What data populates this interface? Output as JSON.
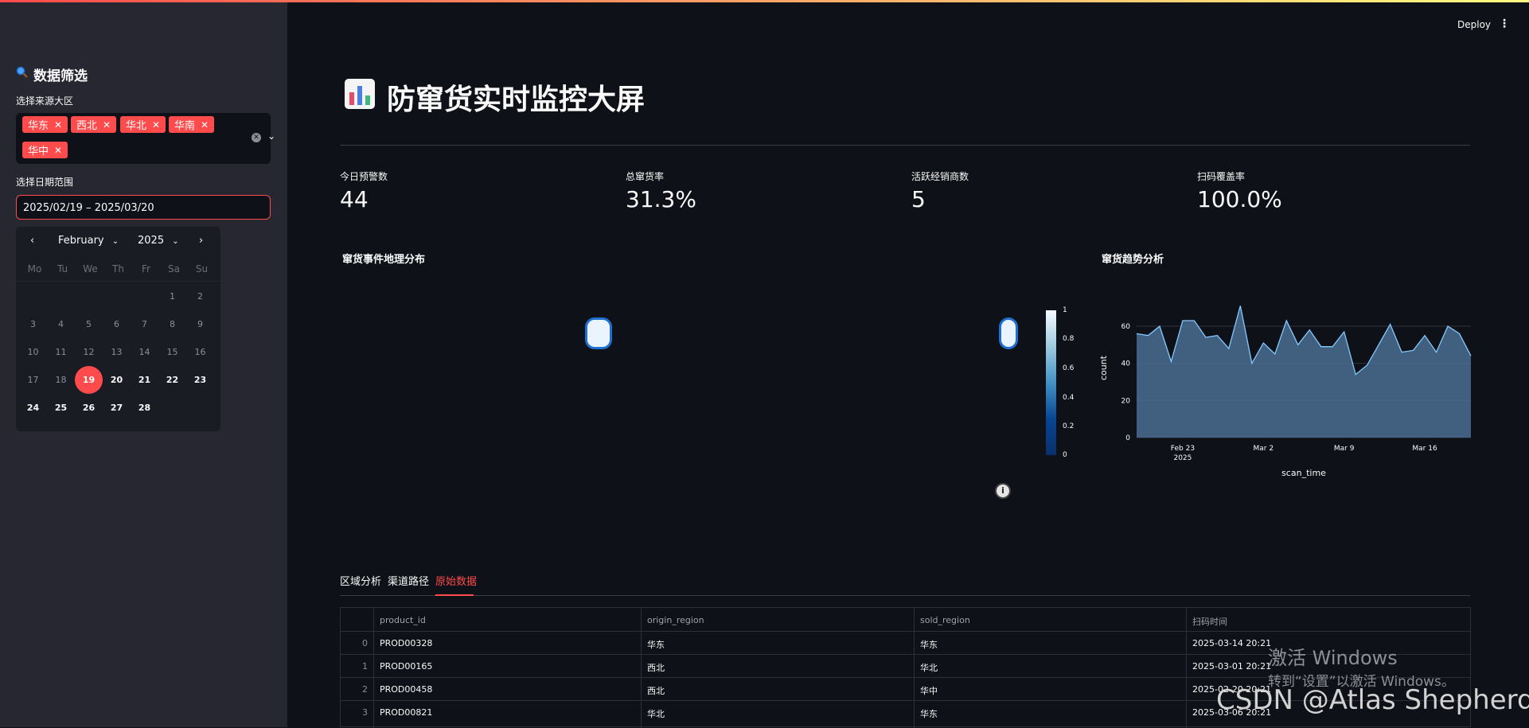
{
  "app": {
    "deploy_label": "Deploy",
    "menu_label": "⋮"
  },
  "sidebar": {
    "title": "数据筛选",
    "region_label": "选择来源大区",
    "region_tags": [
      "华东",
      "西北",
      "华北",
      "华南",
      "华中"
    ],
    "date_label": "选择日期范围",
    "date_value": "2025/02/19 – 2025/03/20",
    "calendar": {
      "month": "February",
      "year": "2025",
      "weekdays": [
        "Mo",
        "Tu",
        "We",
        "Th",
        "Fr",
        "Sa",
        "Su"
      ],
      "selected_day": "19"
    }
  },
  "main": {
    "title": "防窜货实时监控大屏",
    "metrics": [
      {
        "label": "今日预警数",
        "value": "44"
      },
      {
        "label": "总窜货率",
        "value": "31.3%"
      },
      {
        "label": "活跃经销商数",
        "value": "5"
      },
      {
        "label": "扫码覆盖率",
        "value": "100.0%"
      }
    ],
    "map_title": "窜货事件地理分布",
    "colorbar_ticks": [
      "1",
      "0.8",
      "0.6",
      "0.4",
      "0.2",
      "0"
    ],
    "trend_title": "窜货趋势分析",
    "tabs": [
      "区域分析",
      "渠道路径",
      "原始数据"
    ],
    "active_tab": "原始数据",
    "table": {
      "columns": [
        "product_id",
        "origin_region",
        "sold_region",
        "扫码时间"
      ],
      "rows": [
        {
          "idx": "0",
          "product_id": "PROD00328",
          "origin_region": "华东",
          "sold_region": "华东",
          "time": "2025-03-14 20:21"
        },
        {
          "idx": "1",
          "product_id": "PROD00165",
          "origin_region": "西北",
          "sold_region": "华北",
          "time": "2025-03-01 20:21"
        },
        {
          "idx": "2",
          "product_id": "PROD00458",
          "origin_region": "西北",
          "sold_region": "华中",
          "time": "2025-02-20 20:21"
        },
        {
          "idx": "3",
          "product_id": "PROD00821",
          "origin_region": "华北",
          "sold_region": "华东",
          "time": "2025-03-06 20:21"
        }
      ]
    }
  },
  "chart_data": {
    "type": "area",
    "title": "窜货趋势分析",
    "xlabel": "scan_time",
    "ylabel": "count",
    "x_tick_labels": [
      "Feb 23\n2025",
      "Mar 2",
      "Mar 9",
      "Mar 16"
    ],
    "y_tick_labels": [
      "0",
      "20",
      "40",
      "60"
    ],
    "ylim": [
      0,
      75
    ],
    "x": [
      "2025-02-19",
      "2025-02-20",
      "2025-02-21",
      "2025-02-22",
      "2025-02-23",
      "2025-02-24",
      "2025-02-25",
      "2025-02-26",
      "2025-02-27",
      "2025-02-28",
      "2025-03-01",
      "2025-03-02",
      "2025-03-03",
      "2025-03-04",
      "2025-03-05",
      "2025-03-06",
      "2025-03-07",
      "2025-03-08",
      "2025-03-09",
      "2025-03-10",
      "2025-03-11",
      "2025-03-12",
      "2025-03-13",
      "2025-03-14",
      "2025-03-15",
      "2025-03-16",
      "2025-03-17",
      "2025-03-18",
      "2025-03-19",
      "2025-03-20"
    ],
    "values": [
      56,
      55,
      60,
      41,
      63,
      63,
      54,
      55,
      48,
      71,
      40,
      51,
      45,
      63,
      50,
      58,
      49,
      49,
      57,
      34,
      39,
      50,
      61,
      46,
      47,
      55,
      46,
      60,
      56,
      44
    ],
    "color": "#4a6e93",
    "line_color": "#83c9ff",
    "grid": true
  },
  "watermark": {
    "line1": "激活 Windows",
    "line2": "转到“设置”以激活 Windows。",
    "line3": "CSDN @Atlas Shepherd"
  }
}
